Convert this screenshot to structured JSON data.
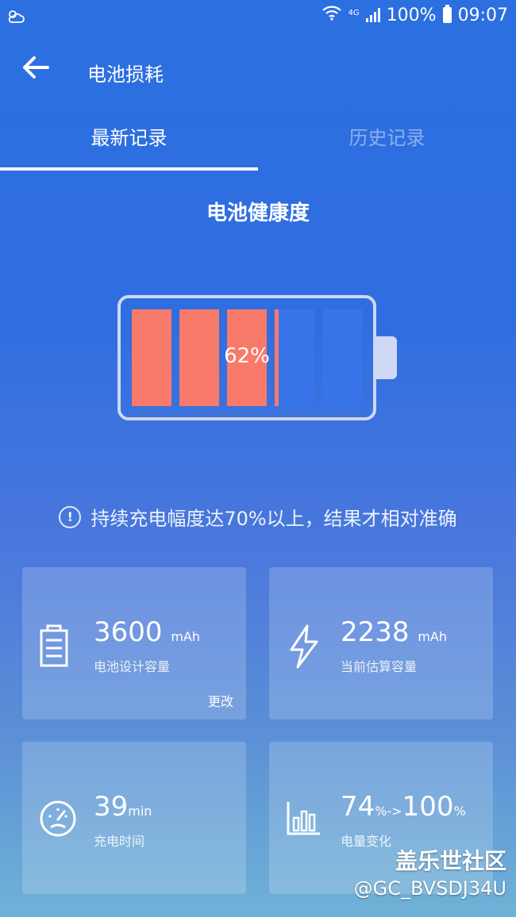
{
  "status_bar": {
    "battery_percent": "100%",
    "time": "09:07",
    "network": "4G"
  },
  "header": {
    "title": "电池损耗"
  },
  "tabs": [
    {
      "label": "最新记录"
    },
    {
      "label": "历史记录"
    }
  ],
  "health": {
    "title": "电池健康度",
    "percent_text": "62%",
    "percent": 0.62
  },
  "notice": {
    "text": "持续充电幅度达70%以上，结果才相对准确"
  },
  "cards": [
    {
      "value": "3600",
      "unit": "mAh",
      "label": "电池设计容量",
      "action": "更改",
      "icon": "battery-outline-icon"
    },
    {
      "value": "2238",
      "unit": "mAh",
      "label": "当前估算容量",
      "icon": "lightning-icon"
    },
    {
      "value": "39",
      "unit": "min",
      "label": "充电时间",
      "icon": "speedometer-icon"
    },
    {
      "value": "74",
      "unit": "%->",
      "value2": "100",
      "unit2": "%",
      "label": "电量变化",
      "icon": "bar-chart-icon"
    }
  ],
  "watermark": {
    "line1": "盖乐世社区",
    "line2": "@GC_BVSDJ34U"
  },
  "colors": {
    "accent_fill": "#f87a6a",
    "cell_empty": "#3674e8",
    "background_top": "#2b6fe0"
  }
}
